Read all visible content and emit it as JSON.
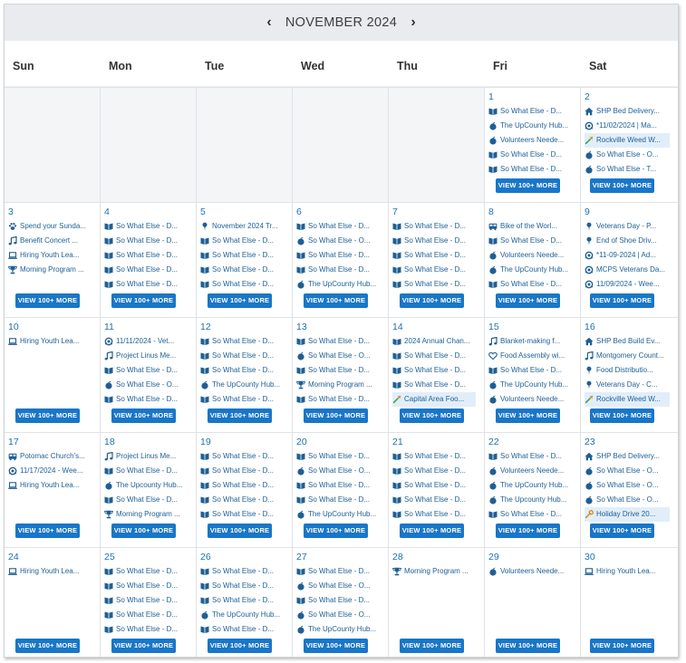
{
  "header": {
    "month_label": "NOVEMBER 2024",
    "prev_glyph": "‹",
    "next_glyph": "›"
  },
  "weekdays": [
    "Sun",
    "Mon",
    "Tue",
    "Wed",
    "Thu",
    "Fri",
    "Sat"
  ],
  "more_label": "VIEW 100+ MORE",
  "colors": {
    "accent": "#1976c8",
    "header_bg": "#e9ebee",
    "highlight_bg": "#e1eef9",
    "day_number": "#1e6fb3"
  },
  "weeks": [
    [
      {
        "empty": true
      },
      {
        "empty": true
      },
      {
        "empty": true
      },
      {
        "empty": true
      },
      {
        "empty": true
      },
      {
        "day": "1",
        "events": [
          {
            "icon": "book-icon",
            "text": "So What Else - D..."
          },
          {
            "icon": "apple-icon",
            "text": "The UpCounty Hub..."
          },
          {
            "icon": "apple-icon",
            "text": "Volunteers Neede..."
          },
          {
            "icon": "book-icon",
            "text": "So What Else - D..."
          },
          {
            "icon": "book-icon",
            "text": "So What Else - D..."
          }
        ]
      },
      {
        "day": "2",
        "events": [
          {
            "icon": "house-icon",
            "text": "SHP Bed Delivery..."
          },
          {
            "icon": "hands-icon",
            "text": "*11/02/2024 | Ma..."
          },
          {
            "icon": "shovel-icon",
            "text": "Rockville Weed W...",
            "highlight": true
          },
          {
            "icon": "apple-icon",
            "text": "So What Else - O..."
          },
          {
            "icon": "apple-icon",
            "text": "So What Else - T..."
          }
        ]
      }
    ],
    [
      {
        "day": "3",
        "events": [
          {
            "icon": "paw-icon",
            "text": "Spend your Sunda..."
          },
          {
            "icon": "music-icon",
            "text": "Benefit Concert ..."
          },
          {
            "icon": "laptop-icon",
            "text": "Hiring Youth Lea..."
          },
          {
            "icon": "trophy-icon",
            "text": "Morning Program ..."
          }
        ]
      },
      {
        "day": "4",
        "events": [
          {
            "icon": "book-icon",
            "text": "So What Else - D..."
          },
          {
            "icon": "book-icon",
            "text": "So What Else - D..."
          },
          {
            "icon": "book-icon",
            "text": "So What Else - D..."
          },
          {
            "icon": "book-icon",
            "text": "So What Else - D..."
          },
          {
            "icon": "book-icon",
            "text": "So What Else - D..."
          }
        ]
      },
      {
        "day": "5",
        "events": [
          {
            "icon": "pin-icon",
            "text": "November 2024 Tr..."
          },
          {
            "icon": "book-icon",
            "text": "So What Else - D..."
          },
          {
            "icon": "book-icon",
            "text": "So What Else - D..."
          },
          {
            "icon": "book-icon",
            "text": "So What Else - D..."
          },
          {
            "icon": "book-icon",
            "text": "So What Else - D..."
          }
        ]
      },
      {
        "day": "6",
        "events": [
          {
            "icon": "book-icon",
            "text": "So What Else - D..."
          },
          {
            "icon": "apple-icon",
            "text": "So What Else - O..."
          },
          {
            "icon": "book-icon",
            "text": "So What Else - D..."
          },
          {
            "icon": "book-icon",
            "text": "So What Else - D..."
          },
          {
            "icon": "apple-icon",
            "text": "The UpCounty Hub..."
          }
        ]
      },
      {
        "day": "7",
        "events": [
          {
            "icon": "book-icon",
            "text": "So What Else - D..."
          },
          {
            "icon": "book-icon",
            "text": "So What Else - D..."
          },
          {
            "icon": "book-icon",
            "text": "So What Else - D..."
          },
          {
            "icon": "book-icon",
            "text": "So What Else - D..."
          },
          {
            "icon": "book-icon",
            "text": "So What Else - D..."
          }
        ]
      },
      {
        "day": "8",
        "events": [
          {
            "icon": "bus-icon",
            "text": "Bike of the Worl..."
          },
          {
            "icon": "book-icon",
            "text": "So What Else - D..."
          },
          {
            "icon": "apple-icon",
            "text": "Volunteers Neede..."
          },
          {
            "icon": "apple-icon",
            "text": "The UpCounty Hub..."
          },
          {
            "icon": "book-icon",
            "text": "So What Else - D..."
          }
        ]
      },
      {
        "day": "9",
        "events": [
          {
            "icon": "pin-icon",
            "text": "Veterans Day - P..."
          },
          {
            "icon": "pin-icon",
            "text": "End of Shoe Driv..."
          },
          {
            "icon": "hands-icon",
            "text": "*11-09-2024 | Ad..."
          },
          {
            "icon": "hands-icon",
            "text": "MCPS Veterans Da..."
          },
          {
            "icon": "hands-icon",
            "text": "11/09/2024 - Wee..."
          }
        ]
      }
    ],
    [
      {
        "day": "10",
        "events": [
          {
            "icon": "laptop-icon",
            "text": "Hiring Youth Lea..."
          }
        ]
      },
      {
        "day": "11",
        "events": [
          {
            "icon": "hands-icon",
            "text": "11/11/2024 - Vet..."
          },
          {
            "icon": "music-icon",
            "text": "Project Linus Me..."
          },
          {
            "icon": "book-icon",
            "text": "So What Else - D..."
          },
          {
            "icon": "apple-icon",
            "text": "So What Else - O..."
          },
          {
            "icon": "book-icon",
            "text": "So What Else - D..."
          }
        ]
      },
      {
        "day": "12",
        "events": [
          {
            "icon": "book-icon",
            "text": "So What Else - D..."
          },
          {
            "icon": "book-icon",
            "text": "So What Else - D..."
          },
          {
            "icon": "book-icon",
            "text": "So What Else - D..."
          },
          {
            "icon": "apple-icon",
            "text": "The UpCounty Hub..."
          },
          {
            "icon": "book-icon",
            "text": "So What Else - D..."
          }
        ]
      },
      {
        "day": "13",
        "events": [
          {
            "icon": "book-icon",
            "text": "So What Else - D..."
          },
          {
            "icon": "apple-icon",
            "text": "So What Else - O..."
          },
          {
            "icon": "book-icon",
            "text": "So What Else - D..."
          },
          {
            "icon": "trophy-icon",
            "text": "Morning Program ..."
          },
          {
            "icon": "book-icon",
            "text": "So What Else - D..."
          }
        ]
      },
      {
        "day": "14",
        "events": [
          {
            "icon": "openbook-icon",
            "text": "2024 Annual Chan..."
          },
          {
            "icon": "book-icon",
            "text": "So What Else - D..."
          },
          {
            "icon": "book-icon",
            "text": "So What Else - D..."
          },
          {
            "icon": "book-icon",
            "text": "So What Else - D..."
          },
          {
            "icon": "shovel-icon",
            "text": "Capital Area Foo...",
            "highlight": true
          }
        ]
      },
      {
        "day": "15",
        "events": [
          {
            "icon": "music-icon",
            "text": "Blanket-making f..."
          },
          {
            "icon": "heart-icon",
            "text": "Food Assembly wi..."
          },
          {
            "icon": "book-icon",
            "text": "So What Else - D..."
          },
          {
            "icon": "apple-icon",
            "text": "The UpCounty Hub..."
          },
          {
            "icon": "apple-icon",
            "text": "Volunteers Neede..."
          }
        ]
      },
      {
        "day": "16",
        "events": [
          {
            "icon": "house-icon",
            "text": "SHP Bed Build Ev..."
          },
          {
            "icon": "music-icon",
            "text": "Montgomery Count..."
          },
          {
            "icon": "pin-icon",
            "text": "Food Distributio..."
          },
          {
            "icon": "pin-icon",
            "text": "Veterans Day - C..."
          },
          {
            "icon": "shovel-icon",
            "text": "Rockville Weed W...",
            "highlight": true
          }
        ]
      }
    ],
    [
      {
        "day": "17",
        "events": [
          {
            "icon": "bus-icon",
            "text": "Potomac Church's..."
          },
          {
            "icon": "hands-icon",
            "text": "11/17/2024 - Wee..."
          },
          {
            "icon": "laptop-icon",
            "text": "Hiring Youth Lea..."
          }
        ]
      },
      {
        "day": "18",
        "events": [
          {
            "icon": "music-icon",
            "text": "Project Linus Me..."
          },
          {
            "icon": "book-icon",
            "text": "So What Else - D..."
          },
          {
            "icon": "apple-icon",
            "text": "The Upcounty Hub..."
          },
          {
            "icon": "book-icon",
            "text": "So What Else - D..."
          },
          {
            "icon": "trophy-icon",
            "text": "Morning Program ..."
          }
        ]
      },
      {
        "day": "19",
        "events": [
          {
            "icon": "book-icon",
            "text": "So What Else - D..."
          },
          {
            "icon": "book-icon",
            "text": "So What Else - D..."
          },
          {
            "icon": "book-icon",
            "text": "So What Else - D..."
          },
          {
            "icon": "book-icon",
            "text": "So What Else - D..."
          },
          {
            "icon": "book-icon",
            "text": "So What Else - D..."
          }
        ]
      },
      {
        "day": "20",
        "events": [
          {
            "icon": "book-icon",
            "text": "So What Else - D..."
          },
          {
            "icon": "apple-icon",
            "text": "So What Else - O..."
          },
          {
            "icon": "book-icon",
            "text": "So What Else - D..."
          },
          {
            "icon": "book-icon",
            "text": "So What Else - D..."
          },
          {
            "icon": "apple-icon",
            "text": "The UpCounty Hub..."
          }
        ]
      },
      {
        "day": "21",
        "events": [
          {
            "icon": "book-icon",
            "text": "So What Else - D..."
          },
          {
            "icon": "book-icon",
            "text": "So What Else - D..."
          },
          {
            "icon": "book-icon",
            "text": "So What Else - D..."
          },
          {
            "icon": "book-icon",
            "text": "So What Else - D..."
          },
          {
            "icon": "book-icon",
            "text": "So What Else - D..."
          }
        ]
      },
      {
        "day": "22",
        "events": [
          {
            "icon": "book-icon",
            "text": "So What Else - D..."
          },
          {
            "icon": "apple-icon",
            "text": "Volunteers Neede..."
          },
          {
            "icon": "apple-icon",
            "text": "The UpCounty Hub..."
          },
          {
            "icon": "apple-icon",
            "text": "The Upcounty Hub..."
          },
          {
            "icon": "book-icon",
            "text": "So What Else - D..."
          }
        ]
      },
      {
        "day": "23",
        "events": [
          {
            "icon": "house-icon",
            "text": "SHP Bed Delivery..."
          },
          {
            "icon": "apple-icon",
            "text": "So What Else - O..."
          },
          {
            "icon": "apple-icon",
            "text": "So What Else - O..."
          },
          {
            "icon": "apple-icon",
            "text": "So What Else - O..."
          },
          {
            "icon": "wrench-icon",
            "text": "Holiday Drive 20...",
            "highlight": true
          }
        ]
      }
    ],
    [
      {
        "day": "24",
        "events": [
          {
            "icon": "laptop-icon",
            "text": "Hiring Youth Lea..."
          }
        ]
      },
      {
        "day": "25",
        "events": [
          {
            "icon": "book-icon",
            "text": "So What Else - D..."
          },
          {
            "icon": "book-icon",
            "text": "So What Else - D..."
          },
          {
            "icon": "book-icon",
            "text": "So What Else - D..."
          },
          {
            "icon": "book-icon",
            "text": "So What Else - D..."
          },
          {
            "icon": "book-icon",
            "text": "So What Else - D..."
          }
        ]
      },
      {
        "day": "26",
        "events": [
          {
            "icon": "book-icon",
            "text": "So What Else - D..."
          },
          {
            "icon": "book-icon",
            "text": "So What Else - D..."
          },
          {
            "icon": "book-icon",
            "text": "So What Else - D..."
          },
          {
            "icon": "apple-icon",
            "text": "The UpCounty Hub..."
          },
          {
            "icon": "book-icon",
            "text": "So What Else - D..."
          }
        ]
      },
      {
        "day": "27",
        "events": [
          {
            "icon": "book-icon",
            "text": "So What Else - D..."
          },
          {
            "icon": "apple-icon",
            "text": "So What Else - O..."
          },
          {
            "icon": "book-icon",
            "text": "So What Else - D..."
          },
          {
            "icon": "apple-icon",
            "text": "So What Else - O..."
          },
          {
            "icon": "apple-icon",
            "text": "The UpCounty Hub..."
          }
        ]
      },
      {
        "day": "28",
        "events": [
          {
            "icon": "trophy-icon",
            "text": "Morning Program ..."
          }
        ]
      },
      {
        "day": "29",
        "events": [
          {
            "icon": "apple-icon",
            "text": "Volunteers Neede..."
          }
        ]
      },
      {
        "day": "30",
        "events": [
          {
            "icon": "laptop-icon",
            "text": "Hiring Youth Lea..."
          }
        ]
      }
    ]
  ]
}
